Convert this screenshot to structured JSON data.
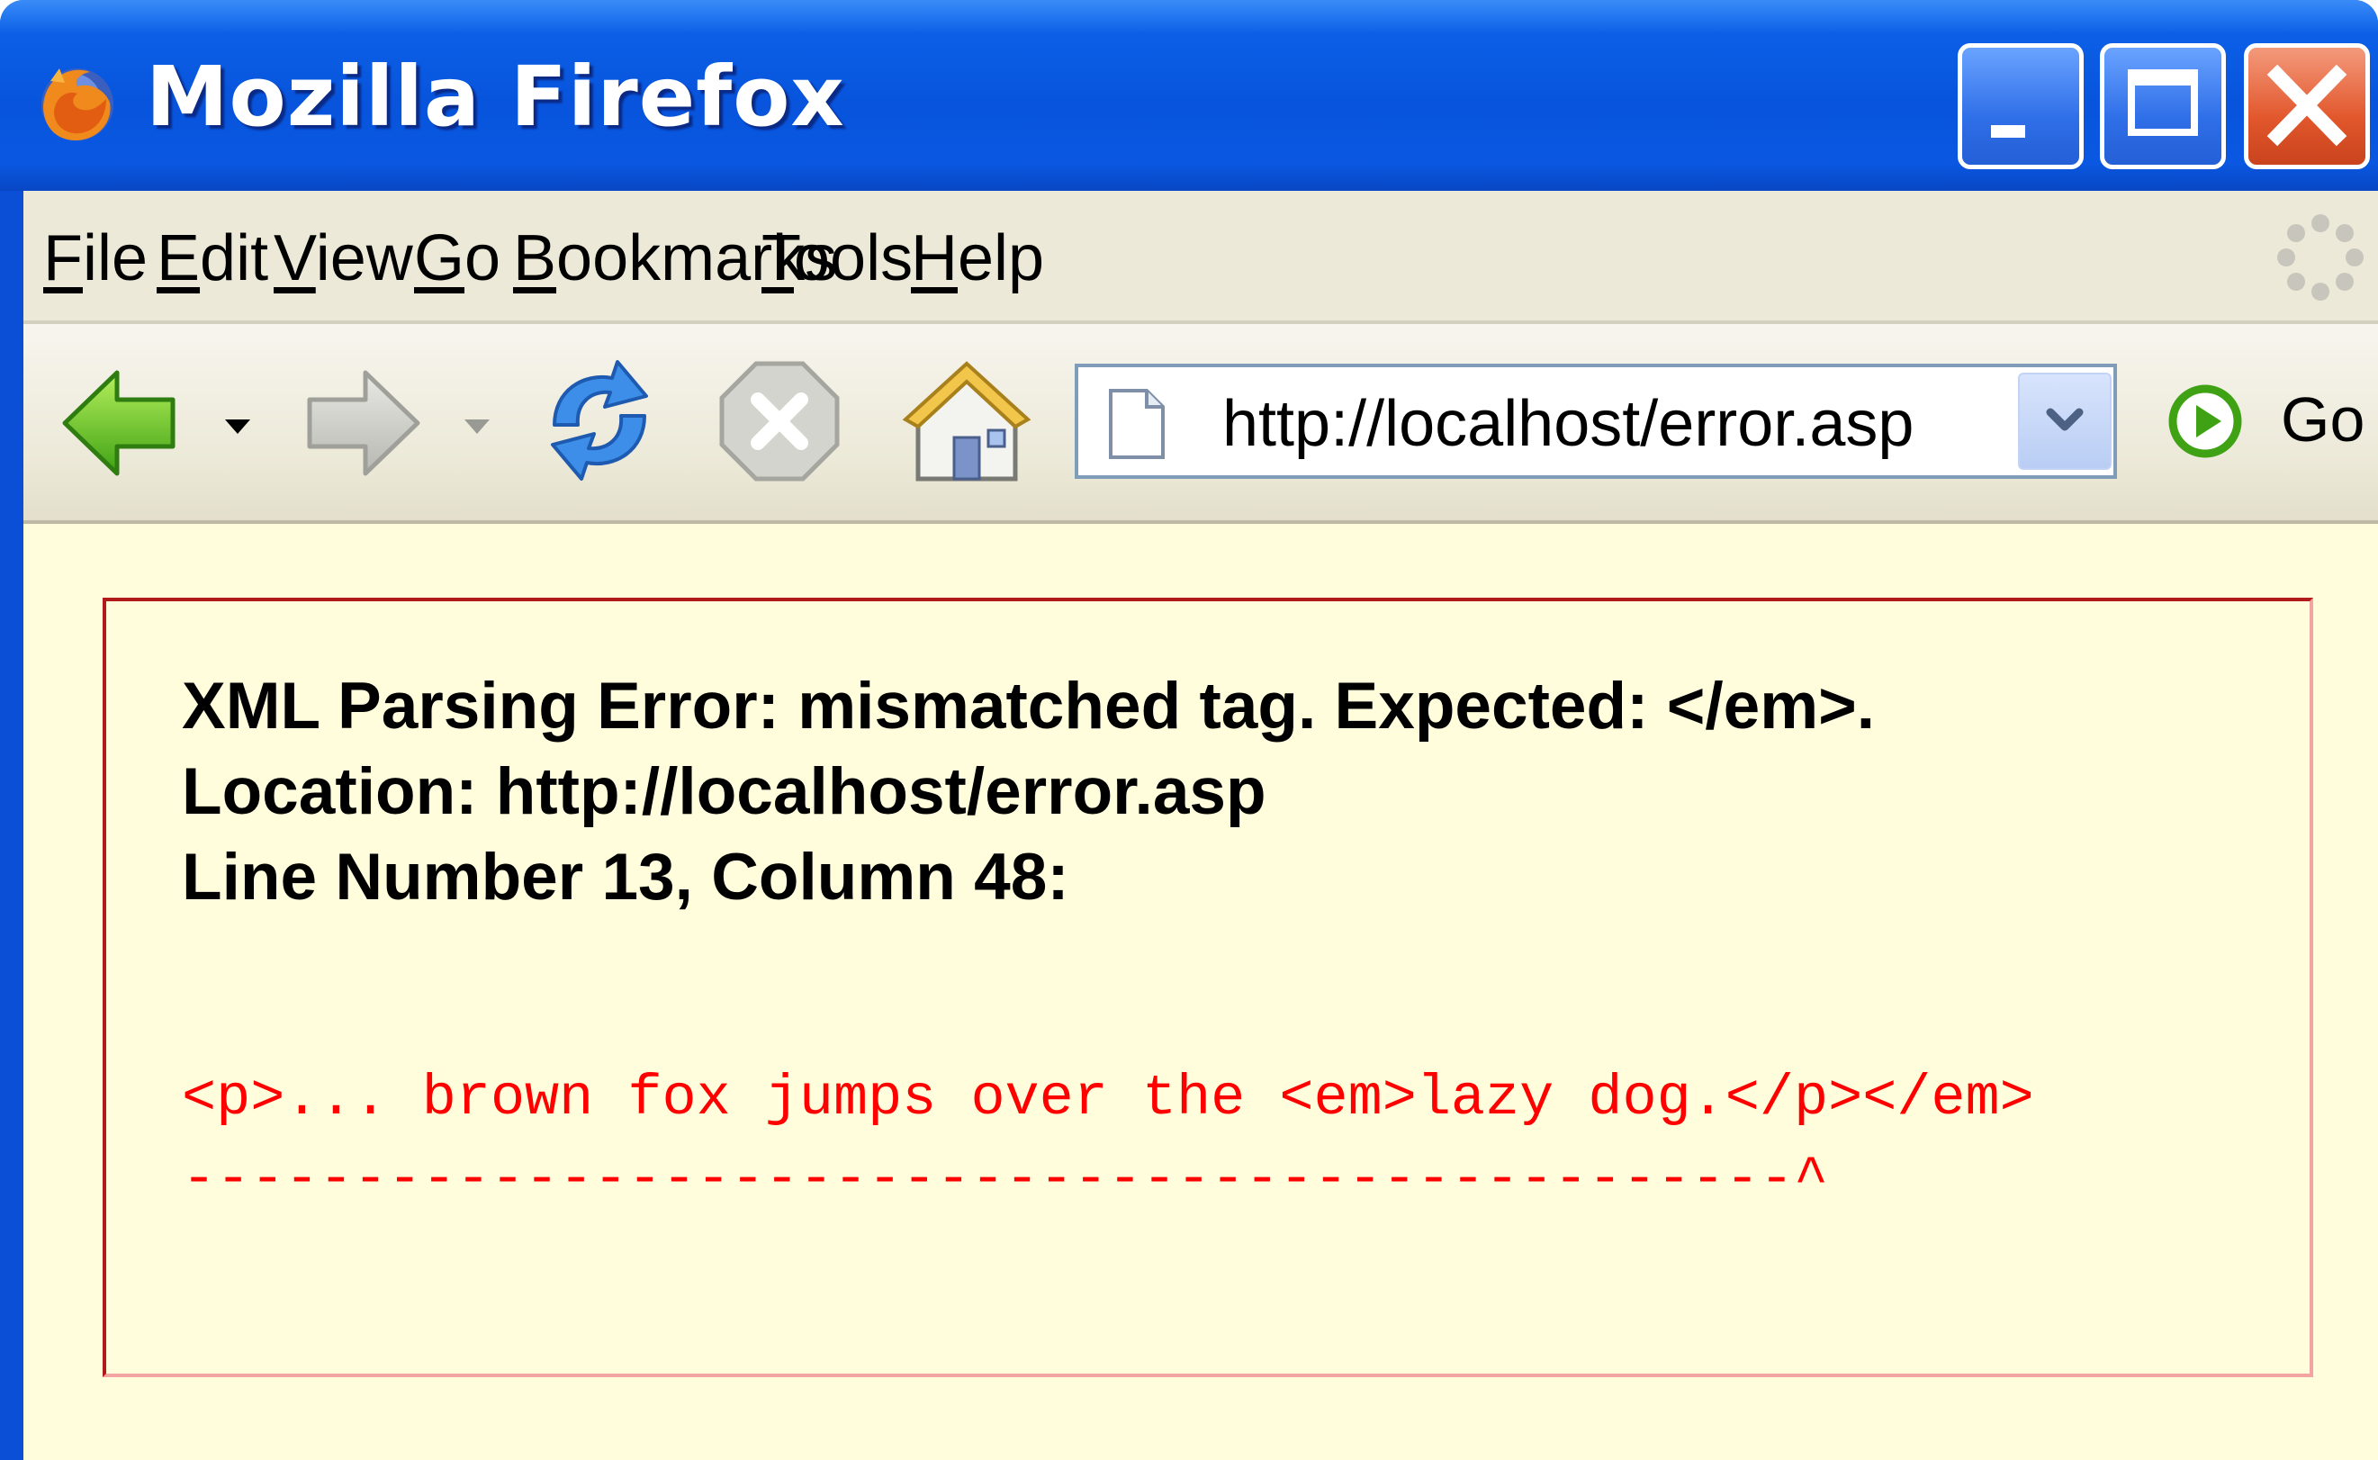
{
  "window": {
    "title": "Mozilla Firefox",
    "logo_icon": "firefox-logo-icon",
    "controls": [
      "minimize-icon",
      "maximize-icon",
      "close-icon"
    ]
  },
  "menubar": {
    "items": [
      {
        "accel": "F",
        "rest": "ile"
      },
      {
        "accel": "E",
        "rest": "dit"
      },
      {
        "accel": "V",
        "rest": "iew"
      },
      {
        "accel": "G",
        "rest": "o"
      },
      {
        "accel": "B",
        "rest": "ookmarks"
      },
      {
        "accel": "T",
        "rest": "ools"
      },
      {
        "accel": "H",
        "rest": "elp"
      }
    ],
    "throbber_icon": "throbber-icon"
  },
  "navbar": {
    "icons": [
      "back-arrow-icon",
      "forward-arrow-icon",
      "reload-icon",
      "stop-icon",
      "home-icon"
    ],
    "address": {
      "value": "http://localhost/error.asp",
      "page_icon": "page-icon",
      "dropdown_icon": "chevron-down-icon"
    },
    "go_label": "Go",
    "go_icon": "go-arrow-icon"
  },
  "error": {
    "line1": "XML Parsing Error: mismatched tag. Expected: </em>.",
    "line2": "Location: http://localhost/error.asp",
    "line3": "Line Number 13, Column 48:",
    "source_text": "<p>... brown fox jumps over the <em>lazy dog.</p></em>",
    "pointer_text": "-----------------------------------------------^"
  },
  "colors": {
    "titlebar": "#0854dc",
    "chrome": "#ece9d8",
    "content_bg": "#fffddc",
    "error_border": "#b01a1a",
    "source_text": "#ff0000"
  }
}
